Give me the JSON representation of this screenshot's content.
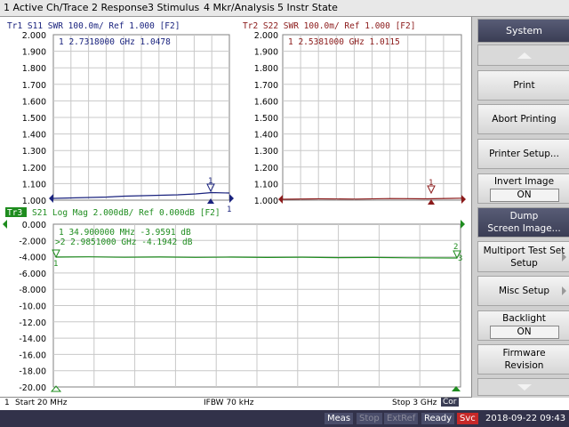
{
  "menu": {
    "items": [
      "1 Active Ch/Trace",
      "2 Response",
      "3 Stimulus",
      "4 Mkr/Analysis",
      "5 Instr State"
    ]
  },
  "trace1": {
    "header": "Tr1  S11  SWR 100.0m/ Ref 1.000 [F2]",
    "marker_readout": "1   2.7318000 GHz   1.0478",
    "y_ticks": [
      "2.000",
      "1.900",
      "1.800",
      "1.700",
      "1.600",
      "1.500",
      "1.400",
      "1.300",
      "1.200",
      "1.100",
      "1.000"
    ],
    "marker_label": "1",
    "ref_label": "1",
    "color": "#1a237e"
  },
  "trace2": {
    "header": "Tr2  S22  SWR 100.0m/ Ref 1.000 [F2]",
    "marker_readout": "1   2.5381000 GHz   1.0115",
    "y_ticks": [
      "2.000",
      "1.900",
      "1.800",
      "1.700",
      "1.600",
      "1.500",
      "1.400",
      "1.300",
      "1.200",
      "1.100",
      "1.000"
    ],
    "marker_label": "1",
    "color": "#8b1a1a"
  },
  "trace3": {
    "badge": "Tr3",
    "header": "S21  Log Mag 2.000dB/ Ref 0.000dB [F2]",
    "marker1_readout": "1   34.900000 MHz  -3.9591 dB",
    "marker2_readout": ">2   2.9851000 GHz  -4.1942 dB",
    "y_ticks": [
      "0.000",
      "-2.000",
      "-4.000",
      "-6.000",
      "-8.000",
      "-10.00",
      "-12.00",
      "-14.00",
      "-16.00",
      "-18.00",
      "-20.00"
    ],
    "marker_labels": [
      "1",
      "2",
      "3"
    ],
    "color": "#1e8c1e"
  },
  "infobar": {
    "channel": "1",
    "start": "Start 20 MHz",
    "ifbw": "IFBW 70 kHz",
    "stop": "Stop 3 GHz",
    "cor": "Cor"
  },
  "softkeys": {
    "title": "System",
    "print": "Print",
    "abort_printing": "Abort Printing",
    "printer_setup": "Printer Setup...",
    "invert_image": "Invert Image",
    "invert_image_state": "ON",
    "dump_screen_line1": "Dump",
    "dump_screen_line2": "Screen Image...",
    "multiport_line1": "Multiport Test Set",
    "multiport_line2": "Setup",
    "misc_setup": "Misc Setup",
    "backlight": "Backlight",
    "backlight_state": "ON",
    "firmware_line1": "Firmware",
    "firmware_line2": "Revision"
  },
  "status": {
    "meas": "Meas",
    "stop": "Stop",
    "extref": "ExtRef",
    "ready": "Ready",
    "svc": "Svc",
    "datetime": "2018-09-22 09:43"
  }
}
